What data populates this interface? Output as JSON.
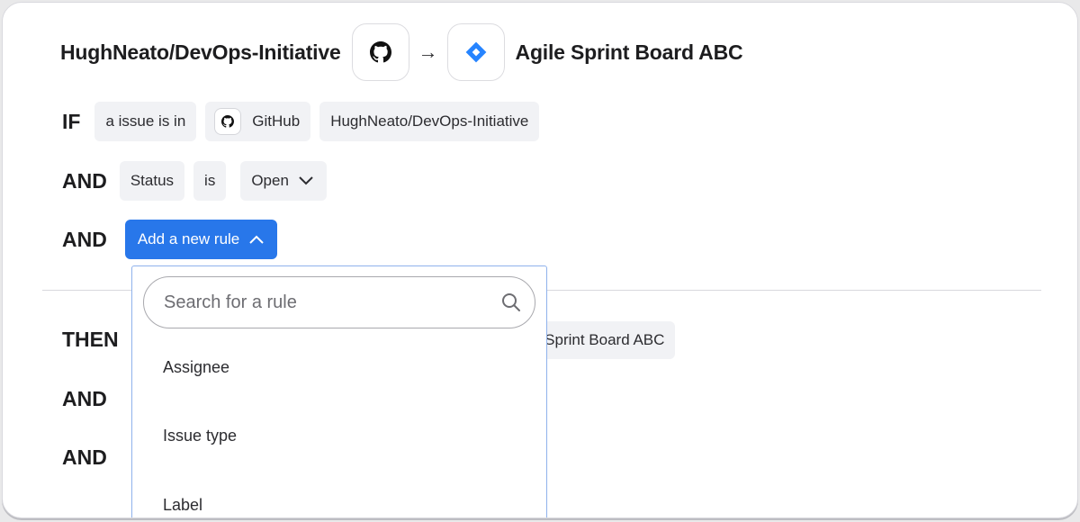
{
  "header": {
    "repo": "HughNeato/DevOps-Initiative",
    "arrow": "→",
    "board": "Agile Sprint Board ABC",
    "source_icon": "github-icon",
    "target_icon": "jira-icon"
  },
  "if_row": {
    "keyword": "IF",
    "chip1": "a issue is in",
    "chip2": "GitHub",
    "chip3": "HughNeato/DevOps-Initiative"
  },
  "and_row1": {
    "keyword": "AND",
    "field": "Status",
    "op": "is",
    "value": "Open"
  },
  "and_row2": {
    "keyword": "AND",
    "button": "Add a new rule"
  },
  "then_section": {
    "then_keyword": "THEN",
    "then_chip_visible": "e Sprint Board ABC",
    "and1": "AND",
    "and2": "AND"
  },
  "dropdown": {
    "search_placeholder": "Search for a rule",
    "options": [
      "Assignee",
      "Issue type",
      "Label"
    ]
  },
  "colors": {
    "accent": "#2877ea",
    "jira": "#2684ff",
    "chip_bg": "#f1f2f5"
  }
}
